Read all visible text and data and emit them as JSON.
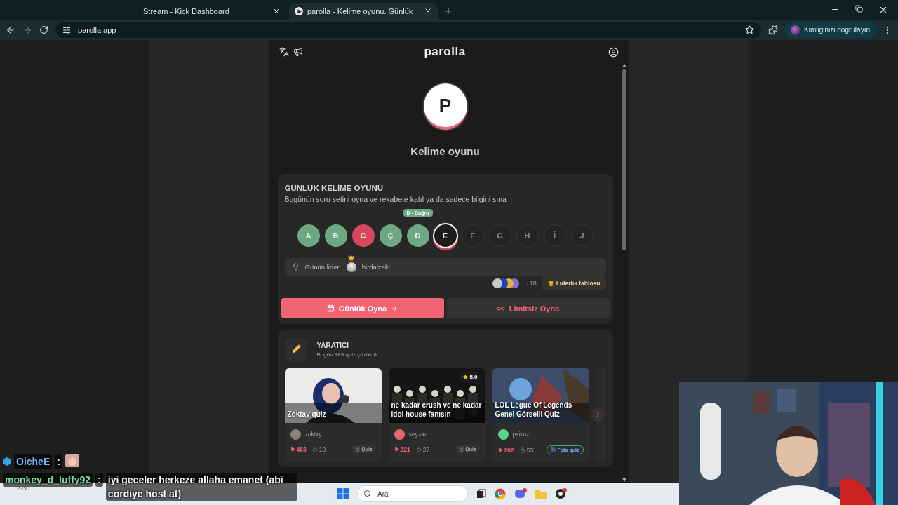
{
  "browser": {
    "tabs": [
      {
        "title": "Stream - Kick Dashboard",
        "selected": false
      },
      {
        "title": "parolla - Kelime oyunu. Günlük",
        "selected": true
      }
    ],
    "new_tab": "+",
    "url": "parolla.app",
    "profile_button": "Kimliğinizi doğrulayın"
  },
  "app": {
    "logo": "parolla",
    "hero_letter": "P",
    "subtitle": "Kelime oyunu",
    "daily": {
      "title": "GÜNLÜK KELİME OYUNU",
      "description": "Bugünün soru setini oyna ve rekabete katıl ya da sadece bilgini sına",
      "letters": [
        {
          "letter": "A",
          "kind": "correct"
        },
        {
          "letter": "B",
          "kind": "correct"
        },
        {
          "letter": "C",
          "kind": "wrong"
        },
        {
          "letter": "Ç",
          "kind": "correct"
        },
        {
          "letter": "D",
          "kind": "correct",
          "tooltip": "D • Doğru"
        },
        {
          "letter": "E",
          "kind": "current"
        },
        {
          "letter": "F",
          "kind": "pending"
        },
        {
          "letter": "G",
          "kind": "pending"
        },
        {
          "letter": "H",
          "kind": "pending"
        },
        {
          "letter": "İ",
          "kind": "pending"
        },
        {
          "letter": "J",
          "kind": "pending"
        }
      ],
      "leader_label": "Günün lideri",
      "leader_name": "birdalzeki",
      "more_count": "+18",
      "leaderboard_button": "Liderlik tablosu",
      "buttons": [
        {
          "label": "Günlük Oyna",
          "kind": "daily",
          "selected": true
        },
        {
          "label": "Limitsiz Oyna",
          "kind": "unlimited",
          "selected": false
        }
      ]
    },
    "creator": {
      "title": "YARATICI",
      "subtitle": "Bugün 189 quiz çözüldü",
      "cards": [
        {
          "title": "Zoktay quiz",
          "author": {
            "name": "zoktxy",
            "color": "#8a7f7a"
          },
          "plays": "468",
          "questions": "10",
          "kind": "quiz",
          "tag": "Quiz"
        },
        {
          "title": "ne kadar crush ve ne kadar idol house fanısın",
          "rating": "5.0",
          "author": {
            "name": "seyzaa",
            "color": "#e8676b"
          },
          "plays": "221",
          "questions": "27",
          "kind": "quiz",
          "tag": "Quiz"
        },
        {
          "title": "LOL Legue Of Legends Genel Görselli Quiz",
          "author": {
            "name": "psikoz",
            "color": "#58d68a"
          },
          "plays": "202",
          "questions": "53",
          "tag": "Foto quiz"
        }
      ]
    }
  },
  "chat": [
    {
      "user": "OicheE",
      "separator": ":"
    },
    {
      "user": "monkey_d_luffy92",
      "separator": ":",
      "message": "iyi geceler herkeze allaha emanet (abi cordiye host at)"
    }
  ],
  "taskbar": {
    "weather": "23°C",
    "search_placeholder": "Ara"
  }
}
